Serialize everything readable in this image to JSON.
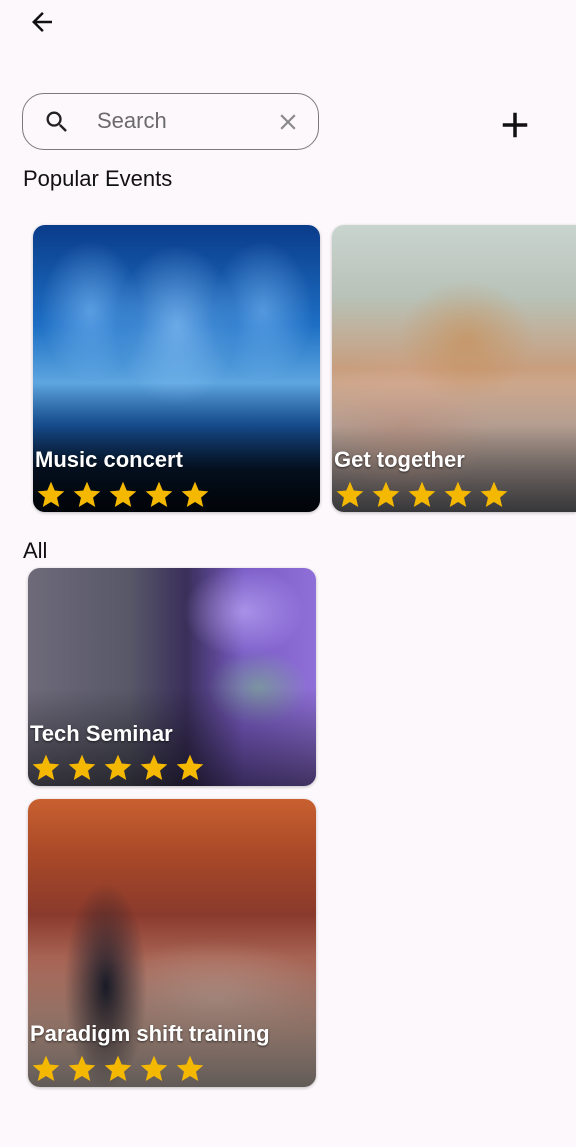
{
  "search": {
    "placeholder": "Search",
    "value": ""
  },
  "sections": {
    "popular": "Popular Events",
    "all": "All"
  },
  "popular_events": [
    {
      "title": "Music concert",
      "rating": 5
    },
    {
      "title": "Get together",
      "rating": 5
    }
  ],
  "all_events": [
    {
      "title": "Tech Seminar",
      "rating": 5
    },
    {
      "title": "Paradigm shift training",
      "rating": 5
    }
  ],
  "icons": {
    "back": "arrow-left-icon",
    "search": "search-icon",
    "clear": "close-icon",
    "add": "plus-icon",
    "star": "star-icon"
  },
  "colors": {
    "star": "#f5b800",
    "background": "#fdf8fc",
    "text": "#111111"
  }
}
